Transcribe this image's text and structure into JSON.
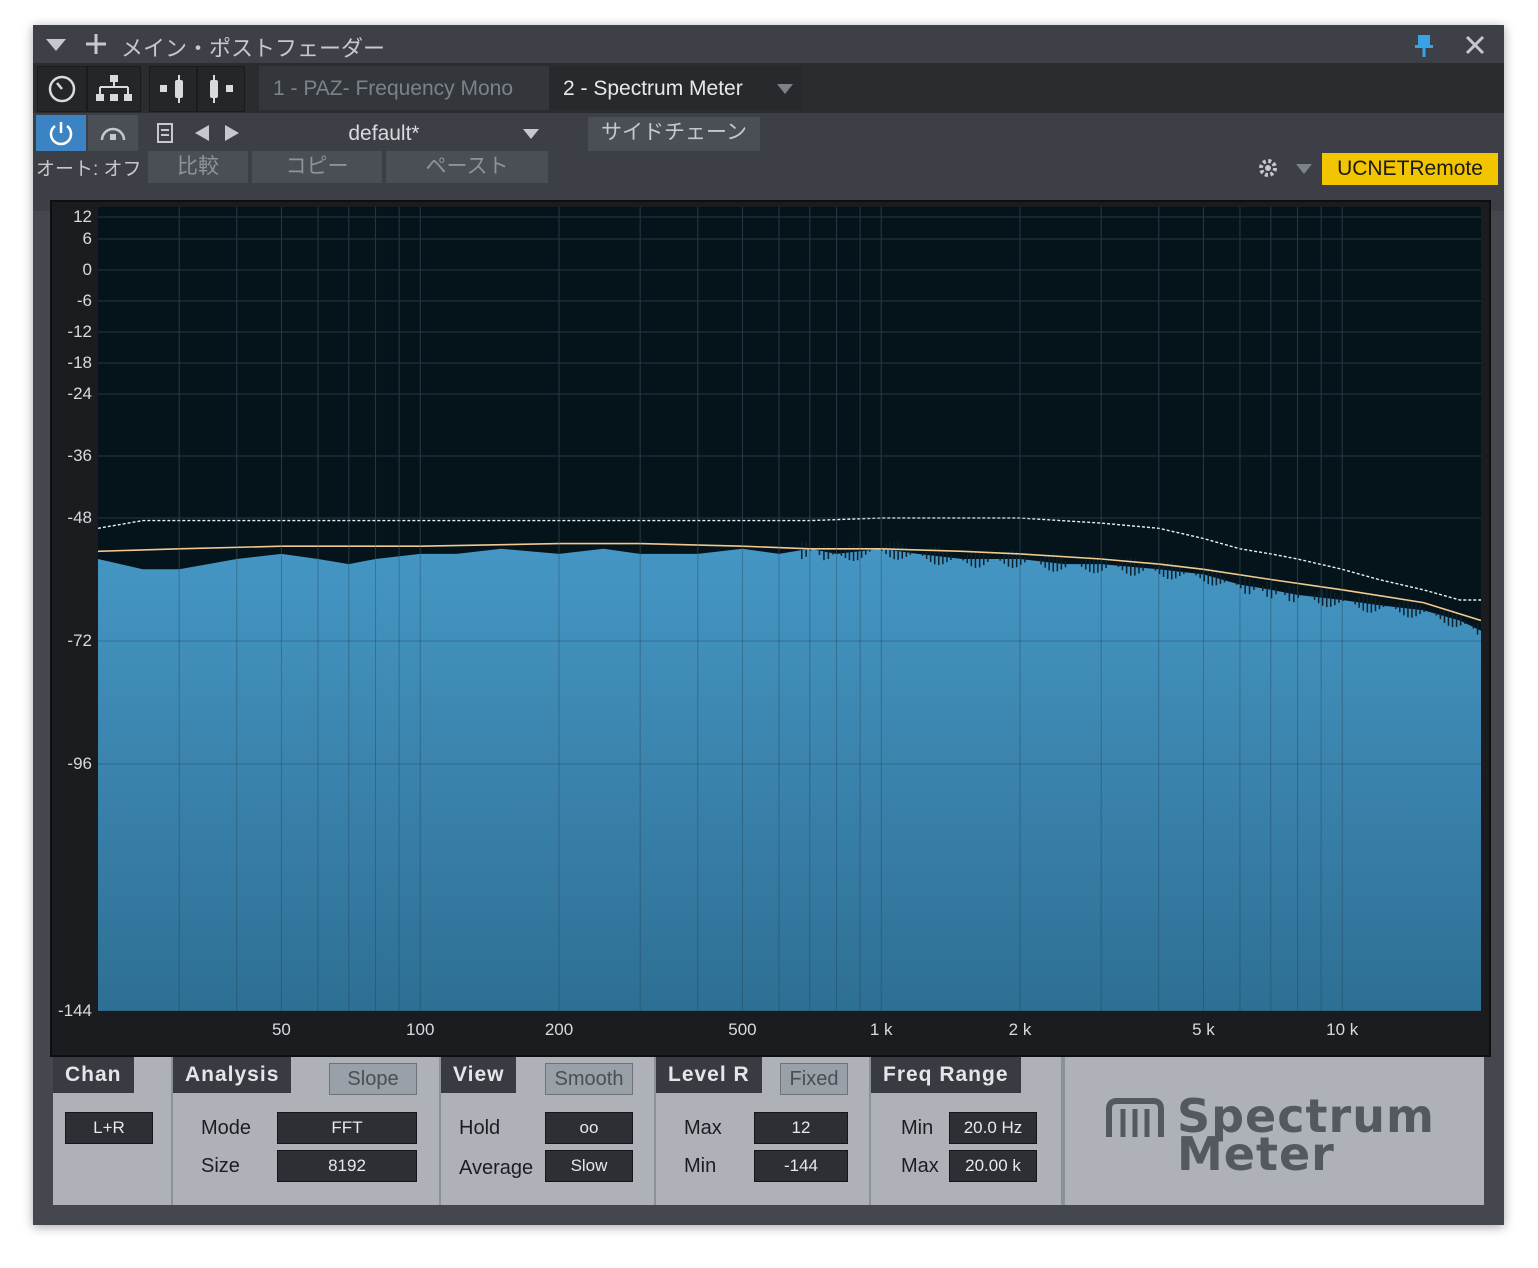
{
  "window": {
    "title": "メイン・ポストフェーダー",
    "menu_icon": "triangle-down",
    "add_icon": "plus",
    "pin_icon": "pin",
    "close_icon": "close-x"
  },
  "tabs": [
    {
      "label": "1 - PAZ- Frequency Mono",
      "active": false
    },
    {
      "label": "2 - Spectrum Meter",
      "active": true
    }
  ],
  "controls": {
    "preset_name": "default*",
    "sidechain_label": "サイドチェーン",
    "auto_label": "オート: オフ",
    "compare_label": "比較",
    "copy_label": "コピー",
    "paste_label": "ペースト",
    "remote_label": "UCNETRemote"
  },
  "chart_data": {
    "type": "area",
    "title": "",
    "xlabel": "",
    "ylabel": "",
    "x_scale": "log",
    "xlim": [
      20,
      20000
    ],
    "x_ticks": [
      {
        "value": 50,
        "label": "50"
      },
      {
        "value": 100,
        "label": "100"
      },
      {
        "value": 200,
        "label": "200"
      },
      {
        "value": 500,
        "label": "500"
      },
      {
        "value": 1000,
        "label": "1 k"
      },
      {
        "value": 2000,
        "label": "2 k"
      },
      {
        "value": 5000,
        "label": "5 k"
      },
      {
        "value": 10000,
        "label": "10 k"
      }
    ],
    "y_ticks": [
      12,
      6,
      0,
      -6,
      -12,
      -18,
      -24,
      -36,
      -48,
      -72,
      -96,
      -144
    ],
    "ylim": [
      -144,
      12
    ],
    "grid": true,
    "series": [
      {
        "role": "spectrum",
        "color": "#3f8fbd",
        "x": [
          20,
          25,
          30,
          40,
          50,
          60,
          70,
          80,
          100,
          120,
          150,
          200,
          250,
          300,
          400,
          500,
          600,
          700,
          800,
          1000,
          1200,
          1500,
          2000,
          2500,
          3000,
          4000,
          5000,
          6000,
          7000,
          8000,
          10000,
          12000,
          15000,
          18000,
          20000
        ],
        "values": [
          -56,
          -58,
          -58,
          -56,
          -55,
          -56,
          -57,
          -56,
          -55,
          -55,
          -54,
          -55,
          -54,
          -55,
          -55,
          -54,
          -55,
          -54,
          -55,
          -54,
          -55,
          -56,
          -56,
          -57,
          -57,
          -58,
          -59,
          -61,
          -62,
          -63,
          -64,
          -65,
          -66,
          -68,
          -70
        ]
      },
      {
        "role": "average",
        "color": "#f2c98e",
        "x": [
          20,
          30,
          50,
          100,
          200,
          300,
          500,
          700,
          1000,
          1500,
          2000,
          3000,
          4000,
          5000,
          7000,
          10000,
          15000,
          20000
        ],
        "values": [
          -54.5,
          -54,
          -53.5,
          -53.5,
          -53,
          -53,
          -53.5,
          -54,
          -54,
          -54.5,
          -55,
          -56,
          -57,
          -58,
          -60,
          -62,
          -64.5,
          -68
        ]
      },
      {
        "role": "peak-hold",
        "color": "#e8f2f7",
        "x": [
          20,
          25,
          30,
          40,
          50,
          70,
          100,
          150,
          200,
          300,
          400,
          500,
          700,
          1000,
          1500,
          2000,
          3000,
          4000,
          5000,
          6000,
          7000,
          8000,
          10000,
          12000,
          15000,
          18000,
          20000
        ],
        "values": [
          -50,
          -48.5,
          -48.5,
          -48.5,
          -48.5,
          -48.5,
          -48.5,
          -48.5,
          -48.5,
          -48.5,
          -48.5,
          -48.5,
          -48.5,
          -48,
          -48,
          -48,
          -49,
          -50,
          -52,
          -54,
          -55,
          -56,
          -58,
          -60,
          -62,
          -64,
          -64
        ]
      }
    ]
  },
  "panel": {
    "chan": {
      "title": "Chan",
      "value": "L+R"
    },
    "analysis": {
      "title": "Analysis",
      "tab": "Slope",
      "mode_label": "Mode",
      "mode_value": "FFT",
      "size_label": "Size",
      "size_value": "8192"
    },
    "view": {
      "title": "View",
      "tab": "Smooth",
      "hold_label": "Hold",
      "hold_value": "oo",
      "average_label": "Average",
      "average_value": "Slow"
    },
    "level": {
      "title": "Level R",
      "tab": "Fixed",
      "max_label": "Max",
      "max_value": "12",
      "min_label": "Min",
      "min_value": "-144"
    },
    "freq": {
      "title": "Freq Range",
      "min_label": "Min",
      "min_value": "20.0 Hz",
      "max_label": "Max",
      "max_value": "20.00 k"
    },
    "logo": {
      "line1": "Spectrum",
      "line2": "Meter"
    }
  }
}
